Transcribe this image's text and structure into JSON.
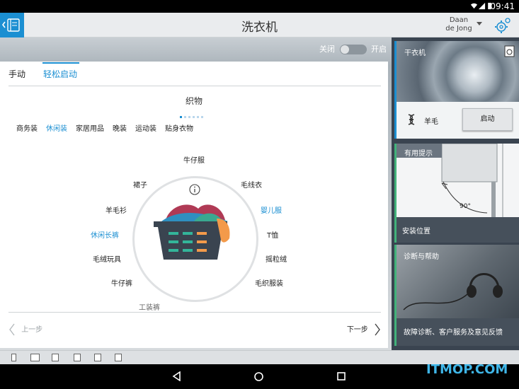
{
  "status_bar": {
    "time": "09:41"
  },
  "app_bar": {
    "title": "洗衣机",
    "user_first": "Daan",
    "user_last": "de Jong"
  },
  "toggle": {
    "off_label": "关闭",
    "on_label": "开启"
  },
  "tabs": [
    {
      "label": "手动"
    },
    {
      "label": "轻松启动"
    }
  ],
  "fabric_title": "织物",
  "categories": [
    {
      "label": "商务装"
    },
    {
      "label": "休闲装"
    },
    {
      "label": "家居用品"
    },
    {
      "label": "晚装"
    },
    {
      "label": "运动装"
    },
    {
      "label": "贴身衣物"
    }
  ],
  "wheel_options": {
    "jeans_wear": "牛仔服",
    "sweater": "毛线衣",
    "baby_clothes": "婴儿服",
    "tshirt": "T恤",
    "fleece": "摇粒绒",
    "knitwear": "毛织服装",
    "workwear": "工装裤",
    "jeans": "牛仔裤",
    "plush_toys": "毛绒玩具",
    "casual_pants": "休闲长裤",
    "cashmere_shirt": "羊毛衫",
    "skirt": "裙子"
  },
  "nav": {
    "prev": "上一步",
    "next": "下一步"
  },
  "sidebar": {
    "dryer": {
      "title": "干衣机",
      "program": "羊毛",
      "start_button": "启动"
    },
    "tips": {
      "title": "有用提示",
      "angle": "90°",
      "caption": "安装位置"
    },
    "help": {
      "title": "诊断与帮助",
      "caption": "故障诊断、客户服务及意见反馈"
    }
  },
  "watermark": "ITMOP.COM",
  "colors": {
    "accent": "#1b8fd2",
    "green": "#42b27a",
    "sidebar_bg": "#3a4450"
  }
}
